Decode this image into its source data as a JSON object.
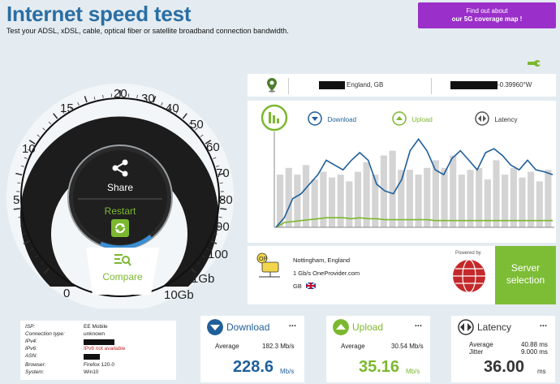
{
  "header": {
    "title": "Internet speed test",
    "subtitle": "Test your ADSL, xDSL, cable, optical fiber or satellite broadband connection bandwidth.",
    "promo_line1": "Find out about",
    "promo_line2": "our 5G coverage map !"
  },
  "gauge": {
    "ticks": [
      "0",
      "5",
      "10",
      "15",
      "20",
      "30",
      "40",
      "50",
      "60",
      "70",
      "80",
      "90",
      "100",
      "1Gb",
      "10Gb"
    ],
    "share_label": "Share",
    "restart_label": "Restart",
    "compare_label": "Compare"
  },
  "location": {
    "place": "England, GB",
    "coords": "-0.39960°W"
  },
  "chart": {
    "download_label": "Download",
    "upload_label": "Upload",
    "latency_label": "Latency"
  },
  "chart_data": {
    "type": "line",
    "series": [
      {
        "name": "Download",
        "color": "#1f5f9a"
      },
      {
        "name": "Upload",
        "color": "#7cb82f"
      },
      {
        "name": "Latency",
        "color": "#cccccc"
      }
    ]
  },
  "server": {
    "city": "Nottingham, England",
    "provider": "1 Gb/s OneProvider.com",
    "country": "GB",
    "powered_by": "Powered by",
    "button_label_1": "Server",
    "button_label_2": "selection"
  },
  "isp": {
    "rows": [
      {
        "label": "ISP:",
        "value": "EE Mobile"
      },
      {
        "label": "Connection type:",
        "value": "unknown"
      },
      {
        "label": "IPv4:",
        "value": ""
      },
      {
        "label": "IPv6:",
        "value": "IPv6 not available"
      },
      {
        "label": "ASN:",
        "value": ""
      },
      {
        "label": "Browser:",
        "value": "Firefox 120.0"
      },
      {
        "label": "System:",
        "value": "Win10"
      }
    ]
  },
  "download": {
    "title": "Download",
    "avg_label": "Average",
    "avg_value": "182.3 Mb/s",
    "value": "228.6",
    "unit": "Mb/s",
    "dots": "..."
  },
  "upload": {
    "title": "Upload",
    "avg_label": "Average",
    "avg_value": "30.54 Mb/s",
    "value": "35.16",
    "unit": "Mb/s",
    "dots": "..."
  },
  "latency": {
    "title": "Latency",
    "avg_label": "Average",
    "avg_value": "40.88 ms",
    "jitter_label": "Jitter",
    "jitter_value": "9.000 ms",
    "value": "36.00",
    "unit": "ms",
    "dots": "..."
  },
  "colors": {
    "title_blue": "#2a6ea3",
    "download_blue": "#1f5f9a",
    "upload_green": "#7cb82f",
    "promo_purple": "#9b2fc9",
    "server_green": "#7dbd36"
  }
}
